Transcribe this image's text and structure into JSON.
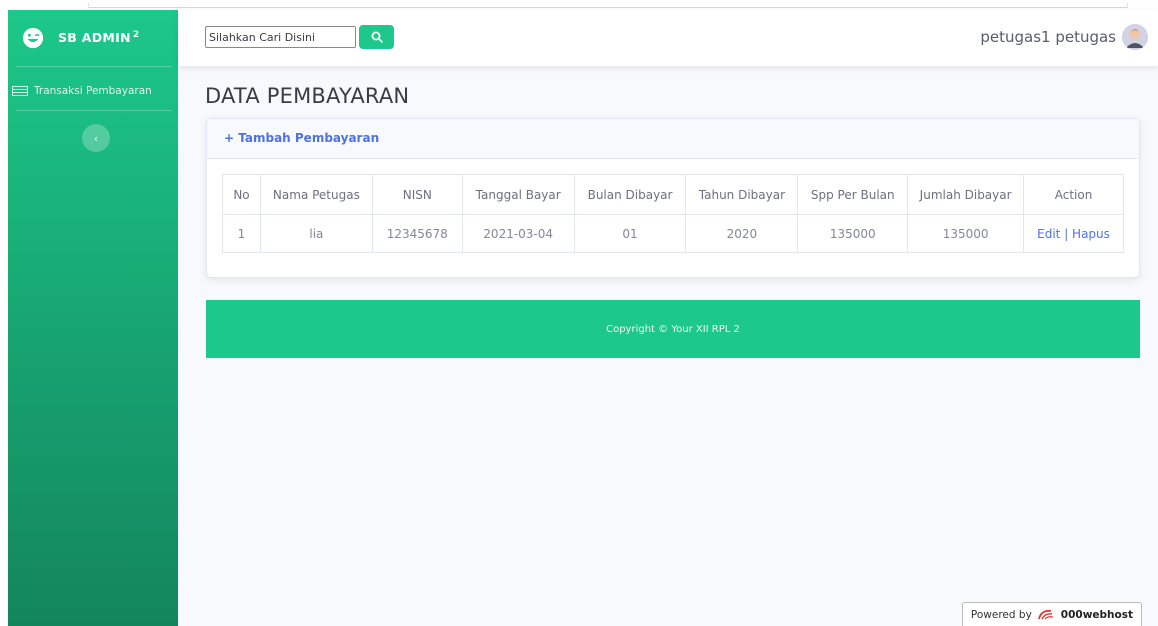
{
  "sidebar": {
    "brand": "SB ADMIN",
    "brand_sup": "2",
    "nav_item": "Transaksi Pembayaran",
    "toggle_glyph": "‹"
  },
  "topbar": {
    "search_value": "Silahkan Cari Disini",
    "user_name": "petugas1 petugas"
  },
  "main": {
    "title": "DATA PEMBAYARAN",
    "add_link": "+ Tambah Pembayaran",
    "table": {
      "headers": [
        "No",
        "Nama Petugas",
        "NISN",
        "Tanggal Bayar",
        "Bulan Dibayar",
        "Tahun Dibayar",
        "Spp Per Bulan",
        "Jumlah Dibayar",
        "Action"
      ],
      "rows": [
        {
          "no": "1",
          "nama_petugas": "lia",
          "nisn": "12345678",
          "tanggal_bayar": "2021-03-04",
          "bulan_dibayar": "01",
          "tahun_dibayar": "2020",
          "spp_per_bulan": "135000",
          "jumlah_dibayar": "135000",
          "edit": "Edit",
          "separator": " | ",
          "hapus": "Hapus"
        }
      ]
    }
  },
  "footer": {
    "copyright": "Copyright © Your XII RPL 2"
  },
  "badge": {
    "powered_by": "Powered by",
    "host": "000webhost"
  },
  "colors": {
    "primary_green": "#1cc88a",
    "link_blue": "#4e73df"
  },
  "icons": [
    "laugh-wink-icon",
    "table-icon",
    "search-icon",
    "chevron-left-icon",
    "user-avatar",
    "webhost-logo-icon"
  ]
}
